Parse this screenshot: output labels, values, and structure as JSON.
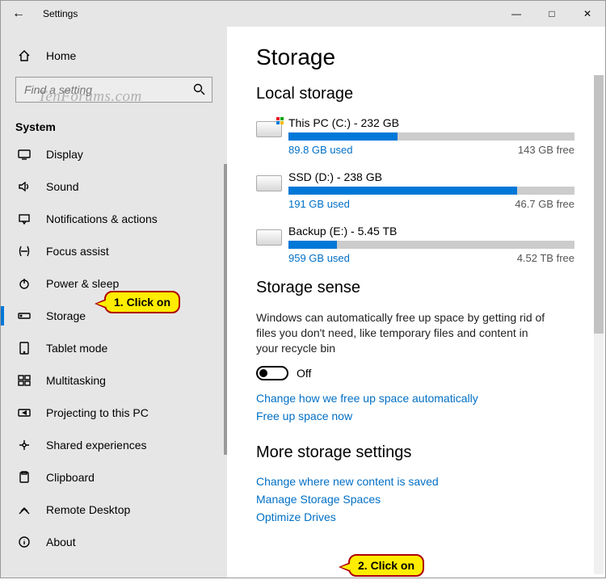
{
  "window": {
    "title": "Settings"
  },
  "watermark": "TenForums.com",
  "sidebar": {
    "home": "Home",
    "search_placeholder": "Find a setting",
    "section": "System",
    "items": [
      {
        "label": "Display"
      },
      {
        "label": "Sound"
      },
      {
        "label": "Notifications & actions"
      },
      {
        "label": "Focus assist"
      },
      {
        "label": "Power & sleep"
      },
      {
        "label": "Storage",
        "selected": true
      },
      {
        "label": "Tablet mode"
      },
      {
        "label": "Multitasking"
      },
      {
        "label": "Projecting to this PC"
      },
      {
        "label": "Shared experiences"
      },
      {
        "label": "Clipboard"
      },
      {
        "label": "Remote Desktop"
      },
      {
        "label": "About"
      }
    ]
  },
  "page": {
    "title": "Storage",
    "local_heading": "Local storage",
    "drives": [
      {
        "name": "This PC (C:) - 232 GB",
        "used": "89.8 GB used",
        "free": "143 GB free",
        "pct": 38,
        "windows": true
      },
      {
        "name": "SSD (D:) - 238 GB",
        "used": "191 GB used",
        "free": "46.7 GB free",
        "pct": 80,
        "windows": false
      },
      {
        "name": "Backup (E:) - 5.45 TB",
        "used": "959 GB used",
        "free": "4.52 TB free",
        "pct": 17,
        "windows": false
      }
    ],
    "sense_heading": "Storage sense",
    "sense_desc": "Windows can automatically free up space by getting rid of files you don't need, like temporary files and content in your recycle bin",
    "toggle_state": "Off",
    "link_change": "Change how we free up space automatically",
    "link_free": "Free up space now",
    "more_heading": "More storage settings",
    "link_content": "Change where new content is saved",
    "link_spaces": "Manage Storage Spaces",
    "link_optimize": "Optimize Drives"
  },
  "callouts": {
    "c1": "1. Click on",
    "c2": "2. Click on"
  }
}
